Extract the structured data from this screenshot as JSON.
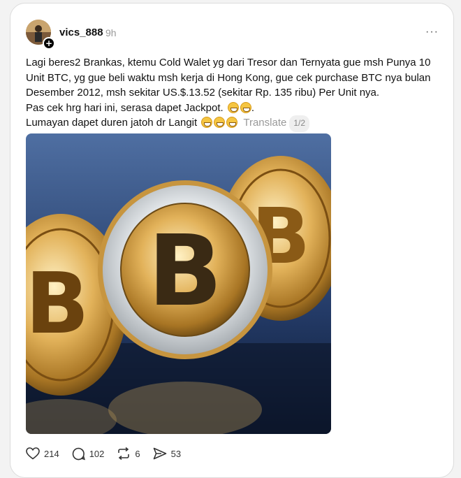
{
  "post": {
    "username": "vics_888",
    "time": "9h",
    "more": "···",
    "lines": [
      "Lagi beres2 Brankas, ktemu Cold Walet yg dari Tresor dan Ternyata gue msh Punya 10 Unit BTC, yg gue beli waktu msh kerja di Hong Kong, gue cek purchase BTC nya bulan Desember 2012, msh sekitar US.$.13.52 (sekitar Rp. 135 ribu) Per Unit nya.",
      "Pas cek hrg hari ini, serasa dapet Jackpot.",
      "Lumayan dapet duren jatoh dr Langit"
    ],
    "translate": "Translate",
    "pager": "1/2",
    "actions": {
      "likes": "214",
      "comments": "102",
      "reposts": "6",
      "shares": "53"
    }
  },
  "icons": [
    "avatar",
    "plus-icon",
    "more-icon",
    "grin-emoji",
    "heart-icon",
    "comment-icon",
    "repost-icon",
    "share-icon"
  ],
  "colors": {
    "background": "#ffffff",
    "muted": "#999999",
    "text": "#111111"
  }
}
